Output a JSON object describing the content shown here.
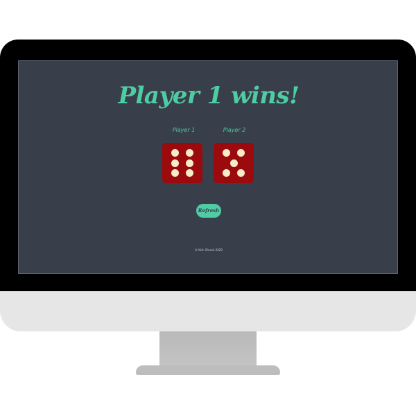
{
  "game": {
    "title": "Player 1 wins!",
    "players": [
      {
        "label": "Player 1",
        "die_value": 6
      },
      {
        "label": "Player 2",
        "die_value": 5
      }
    ],
    "refresh_label": "Refresh",
    "footer": "© Kish Shreck 2020"
  },
  "colors": {
    "screen_background": "#393f4a",
    "accent": "#4ecca3",
    "die_face": "#9b0a0d",
    "die_pip": "#f7ecc9"
  }
}
